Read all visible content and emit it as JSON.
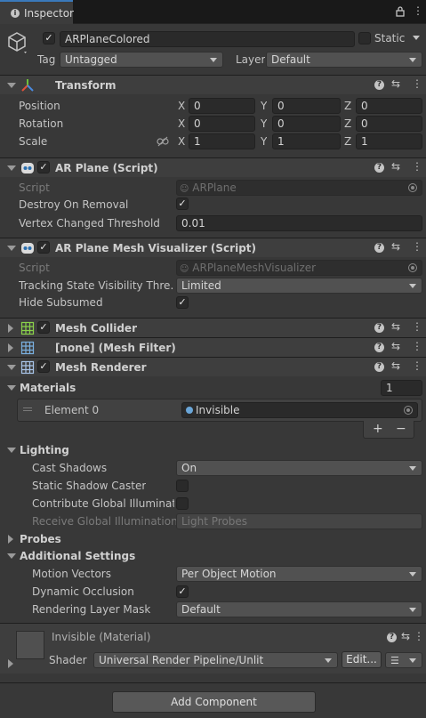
{
  "tab": {
    "title": "Inspector"
  },
  "object": {
    "name": "ARPlaneColored",
    "static_label": "Static",
    "tag_label": "Tag",
    "tag_value": "Untagged",
    "layer_label": "Layer",
    "layer_value": "Default"
  },
  "transform": {
    "title": "Transform",
    "rows": [
      {
        "label": "Position",
        "x": "0",
        "y": "0",
        "z": "0"
      },
      {
        "label": "Rotation",
        "x": "0",
        "y": "0",
        "z": "0"
      },
      {
        "label": "Scale",
        "x": "1",
        "y": "1",
        "z": "1"
      }
    ],
    "axis": {
      "x": "X",
      "y": "Y",
      "z": "Z"
    }
  },
  "ar_plane": {
    "title": "AR Plane (Script)",
    "script_label": "Script",
    "script_value": "ARPlane",
    "destroy_label": "Destroy On Removal",
    "vertex_label": "Vertex Changed Threshold",
    "vertex_value": "0.01"
  },
  "ar_visualizer": {
    "title": "AR Plane Mesh Visualizer (Script)",
    "script_label": "Script",
    "script_value": "ARPlaneMeshVisualizer",
    "tracking_label": "Tracking State Visibility Thre...",
    "tracking_value": "Limited",
    "hide_label": "Hide Subsumed"
  },
  "mesh_collider": {
    "title": "Mesh Collider"
  },
  "mesh_filter": {
    "title": "[none] (Mesh Filter)"
  },
  "mesh_renderer": {
    "title": "Mesh Renderer",
    "materials_label": "Materials",
    "materials_count": "1",
    "element_label": "Element 0",
    "element_value": "Invisible",
    "plus": "+",
    "minus": "−",
    "lighting_label": "Lighting",
    "cast_label": "Cast Shadows",
    "cast_value": "On",
    "static_caster_label": "Static Shadow Caster",
    "contribute_label": "Contribute Global Illuminatio",
    "receive_label": "Receive Global Illumination",
    "receive_value": "Light Probes",
    "probes_label": "Probes",
    "additional_label": "Additional Settings",
    "motion_label": "Motion Vectors",
    "motion_value": "Per Object Motion",
    "occlusion_label": "Dynamic Occlusion",
    "layer_mask_label": "Rendering Layer Mask",
    "layer_mask_value": "Default"
  },
  "material": {
    "title": "Invisible (Material)",
    "shader_label": "Shader",
    "shader_value": "Universal Render Pipeline/Unlit",
    "edit_label": "Edit..."
  },
  "add_component": "Add Component",
  "colors": {
    "background": "#383838",
    "header": "#3e3e3e",
    "field": "#2a2a2a",
    "accent": "#3a79bb"
  }
}
